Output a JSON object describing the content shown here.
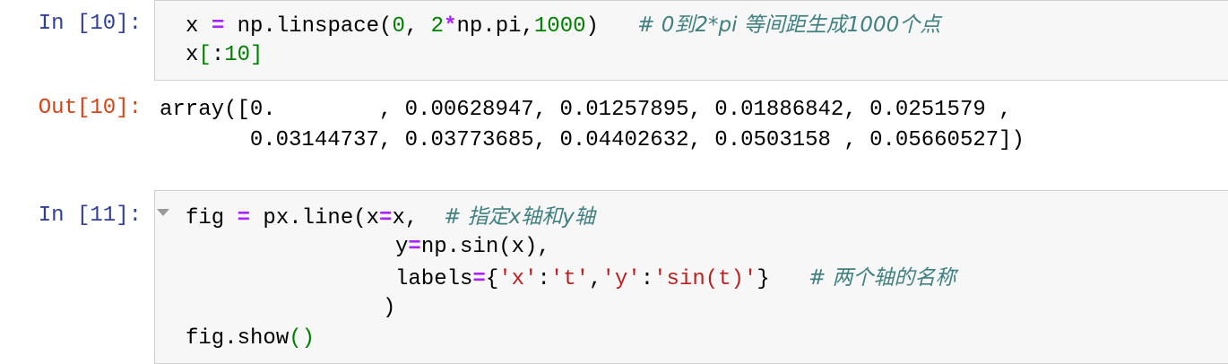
{
  "cells": [
    {
      "in_prompt": "In [10]:",
      "code": {
        "l1_a": "x ",
        "l1_eq": "=",
        "l1_b": " np.linspace(",
        "l1_n0": "0",
        "l1_c": ", ",
        "l1_n2": "2",
        "l1_mul": "*",
        "l1_d": "np.pi,",
        "l1_n1000": "1000",
        "l1_e": ")   ",
        "l1_comment": "# 0到2*pi 等间距生成1000个点",
        "l2_a": "x",
        "l2_br1": "[",
        "l2_colon": ":",
        "l2_n": "10",
        "l2_br2": "]"
      },
      "out_prompt": "Out[10]:",
      "output_line1": "array([0.        , 0.00628947, 0.01257895, 0.01886842, 0.0251579 ,",
      "output_line2": "       0.03144737, 0.03773685, 0.04402632, 0.0503158 , 0.05660527])"
    },
    {
      "in_prompt": "In [11]:",
      "code": {
        "l1_a": "fig ",
        "l1_eq": "=",
        "l1_b": " px.line(x",
        "l1_eq2": "=",
        "l1_c": "x,  ",
        "l1_comment": "# 指定x轴和y轴",
        "l2_a": "y",
        "l2_eq": "=",
        "l2_b": "np.sin(x),",
        "l3_a": "labels",
        "l3_eq": "=",
        "l3_b": "{",
        "l3_s1": "'x'",
        "l3_c1": ":",
        "l3_s2": "'t'",
        "l3_c2": ",",
        "l3_s3": "'y'",
        "l3_c3": ":",
        "l3_s4": "'sin(t)'",
        "l3_c4": "}   ",
        "l3_comment": "# 两个轴的名称",
        "l4": ")",
        "l5_a": "fig.show",
        "l5_br": "()"
      }
    }
  ]
}
